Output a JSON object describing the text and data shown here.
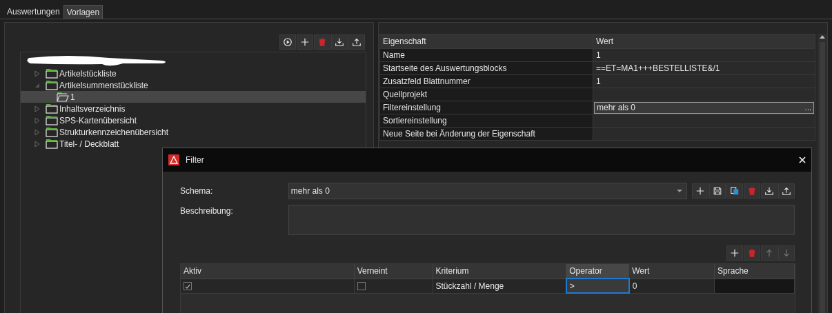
{
  "tabs": [
    {
      "label": "Auswertungen",
      "selected": false
    },
    {
      "label": "Vorlagen",
      "selected": true
    }
  ],
  "tree": {
    "toolbar": [
      {
        "kind": "run"
      },
      {
        "kind": "add"
      },
      {
        "kind": "delete"
      },
      {
        "kind": "import"
      },
      {
        "kind": "export"
      }
    ],
    "items": [
      {
        "label": "Artikelstückliste",
        "expanded": false,
        "selected": false
      },
      {
        "label": "Artikelsummenstückliste",
        "expanded": true,
        "selected": false,
        "children": [
          {
            "label": "1",
            "selected": true
          }
        ]
      },
      {
        "label": "Inhaltsverzeichnis",
        "expanded": false,
        "selected": false
      },
      {
        "label": "SPS-Kartenübersicht",
        "expanded": false,
        "selected": false
      },
      {
        "label": "Strukturkennzeichenübersicht",
        "expanded": false,
        "selected": false
      },
      {
        "label": "Titel- / Deckblatt",
        "expanded": false,
        "selected": false
      }
    ]
  },
  "properties": {
    "columns": [
      "Eigenschaft",
      "Wert"
    ],
    "rows": [
      {
        "name": "Name",
        "value": "1"
      },
      {
        "name": "Startseite des Auswertungsblocks",
        "value": "==ET=MA1+++BESTELLISTE&/1"
      },
      {
        "name": "Zusatzfeld Blattnummer",
        "value": "1"
      },
      {
        "name": "Quellprojekt",
        "value": ""
      },
      {
        "name": "Filtereinstellung",
        "value": "mehr als 0",
        "kind": "editor",
        "button": "..."
      },
      {
        "name": "Sortiereinstellung",
        "value": ""
      },
      {
        "name": "Neue Seite bei Änderung der Eigenschaft",
        "value": ""
      }
    ]
  },
  "dialog": {
    "title": "Filter",
    "schema_label": "Schema:",
    "schema_value": "mehr als 0",
    "description_label": "Beschreibung:",
    "schema_tools": [
      {
        "kind": "add"
      },
      {
        "kind": "save"
      },
      {
        "kind": "copy"
      },
      {
        "kind": "delete"
      },
      {
        "kind": "import"
      },
      {
        "kind": "export"
      }
    ],
    "grid_tools": [
      {
        "kind": "add",
        "disabled": false
      },
      {
        "kind": "delete",
        "disabled": false
      },
      {
        "kind": "up",
        "disabled": true
      },
      {
        "kind": "down",
        "disabled": true
      }
    ],
    "columns": [
      {
        "label": "Aktiv",
        "selected": false
      },
      {
        "label": "Verneint",
        "selected": false
      },
      {
        "label": "Kriterium",
        "selected": false
      },
      {
        "label": "Operator",
        "selected": true
      },
      {
        "label": "Wert",
        "selected": false
      },
      {
        "label": "Sprache",
        "selected": false
      }
    ],
    "rows": [
      {
        "active": true,
        "negated": false,
        "criterion": "Stückzahl / Menge",
        "operator": ">",
        "value": "0"
      }
    ]
  }
}
